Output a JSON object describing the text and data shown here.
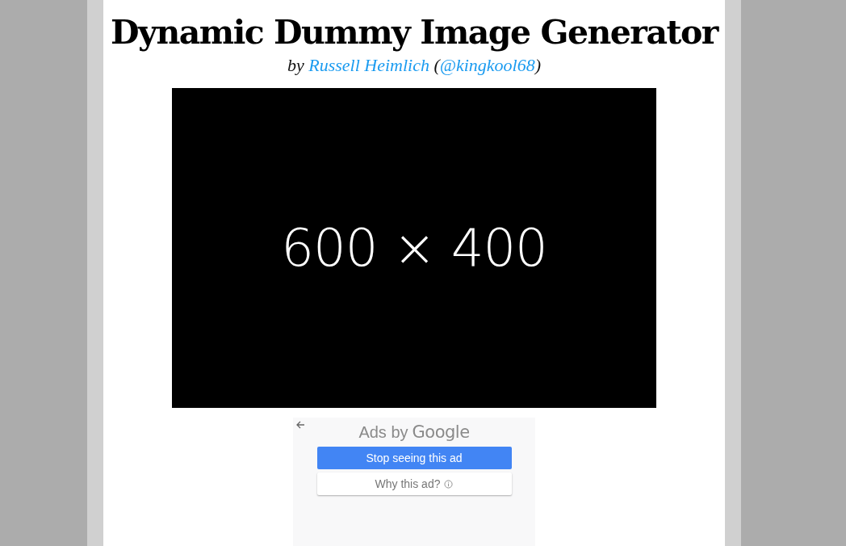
{
  "header": {
    "title": "Dynamic Dummy Image Generator",
    "byline": {
      "prefix": "by ",
      "author": "Russell Heimlich",
      "open": " (",
      "handle": "@kingkool68",
      "close": ")"
    }
  },
  "dummy_image": {
    "label": "600 × 400"
  },
  "ad": {
    "label": "Ads by",
    "brand": "Google",
    "buttons": [
      {
        "kind": "primary",
        "label": "Stop seeing this ad"
      },
      {
        "kind": "secondary",
        "label": "Why this ad?"
      }
    ]
  }
}
